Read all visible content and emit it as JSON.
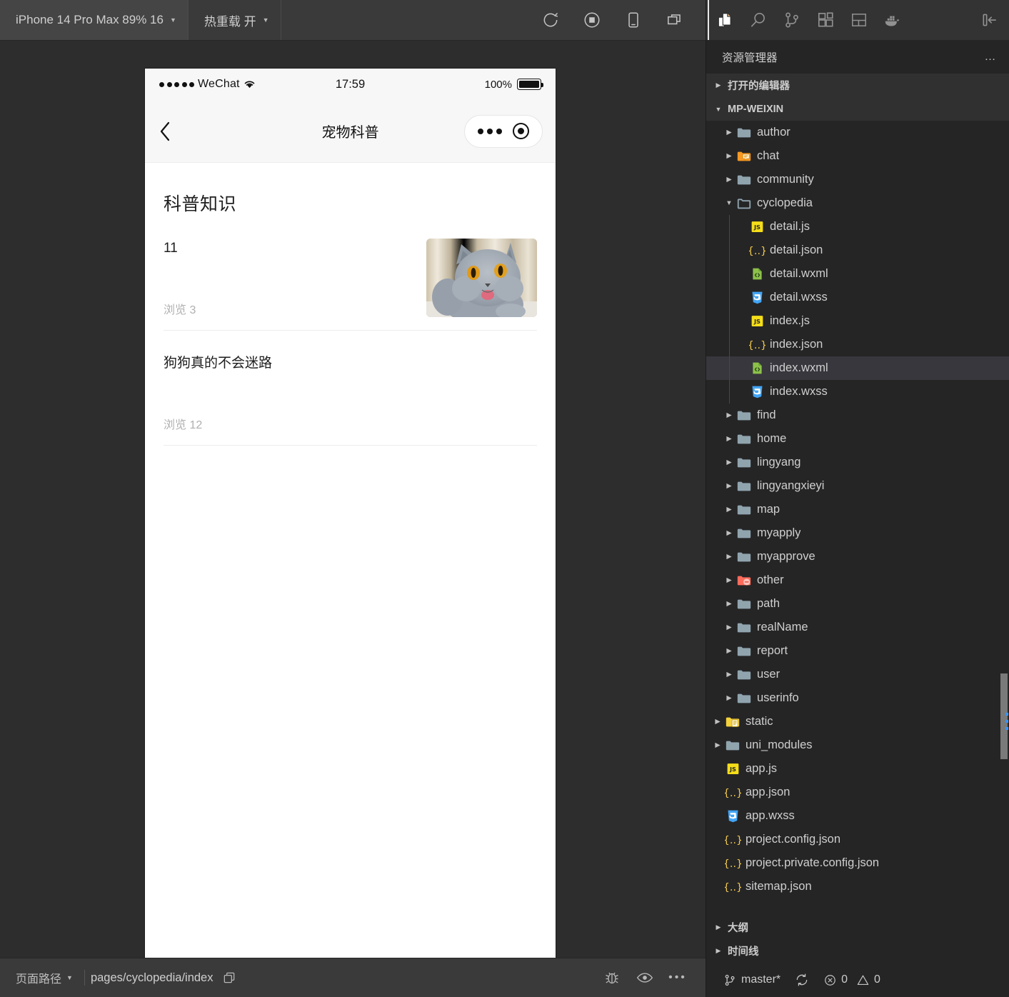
{
  "simulator": {
    "toolbar": {
      "device_label": "iPhone 14 Pro Max 89% 16",
      "hotreload_label": "热重载 开",
      "icons": [
        {
          "name": "refresh-icon",
          "title": "refresh"
        },
        {
          "name": "stop-record-icon",
          "title": "stop"
        },
        {
          "name": "device-icon",
          "title": "device"
        },
        {
          "name": "multi-window-icon",
          "title": "windows"
        }
      ]
    },
    "phone": {
      "status_bar": {
        "carrier": "WeChat",
        "time": "17:59",
        "battery_percent": "100%"
      },
      "nav_bar": {
        "back_icon": "chevron-left-icon",
        "title": "宠物科普",
        "capsule_more": "more-dots-icon",
        "capsule_target": "target-icon"
      },
      "page": {
        "heading": "科普知识",
        "articles": [
          {
            "title": "11",
            "views_label": "浏览",
            "views_count": "3",
            "has_thumb": true
          },
          {
            "title": "狗狗真的不会迷路",
            "views_label": "浏览",
            "views_count": "12",
            "has_thumb": false
          }
        ]
      }
    },
    "status_bar": {
      "page_path_label": "页面路径",
      "page_path_value": "pages/cyclopedia/index",
      "copy_icon": "copy-icon",
      "right_icons": [
        {
          "name": "bug-icon"
        },
        {
          "name": "eye-icon"
        },
        {
          "name": "more-dots-icon"
        }
      ]
    }
  },
  "vscode": {
    "activity_bar": [
      {
        "name": "explorer-icon",
        "label": "资源管理器",
        "active": true
      },
      {
        "name": "search-icon",
        "label": "搜索",
        "active": false
      },
      {
        "name": "source-control-icon",
        "label": "源代码管理",
        "active": false
      },
      {
        "name": "extensions-icon",
        "label": "扩展",
        "active": false
      },
      {
        "name": "layout-panel-icon",
        "label": "布局",
        "active": false
      },
      {
        "name": "docker-icon",
        "label": "Docker",
        "active": false
      }
    ],
    "collapse_icon": "collapse-panel-icon",
    "panel_title": "资源管理器",
    "panel_more": "…",
    "sections": {
      "open_editors": "打开的编辑器",
      "workspace": "MP-WEIXIN",
      "outline": "大纲",
      "timeline": "时间线"
    },
    "tree": [
      {
        "label": "author",
        "type": "folder",
        "indent": 1,
        "expanded": false,
        "icon": "folder-icon"
      },
      {
        "label": "chat",
        "type": "folder-chat",
        "indent": 1,
        "expanded": false,
        "icon": "folder-chat-icon"
      },
      {
        "label": "community",
        "type": "folder",
        "indent": 1,
        "expanded": false,
        "icon": "folder-icon"
      },
      {
        "label": "cyclopedia",
        "type": "folder",
        "indent": 1,
        "expanded": true,
        "icon": "folder-open-icon"
      },
      {
        "label": "detail.js",
        "type": "js",
        "indent": 2,
        "icon": "js-file-icon"
      },
      {
        "label": "detail.json",
        "type": "json",
        "indent": 2,
        "icon": "json-file-icon"
      },
      {
        "label": "detail.wxml",
        "type": "wxml",
        "indent": 2,
        "icon": "wxml-file-icon"
      },
      {
        "label": "detail.wxss",
        "type": "wxss",
        "indent": 2,
        "icon": "wxss-file-icon"
      },
      {
        "label": "index.js",
        "type": "js",
        "indent": 2,
        "icon": "js-file-icon"
      },
      {
        "label": "index.json",
        "type": "json",
        "indent": 2,
        "icon": "json-file-icon"
      },
      {
        "label": "index.wxml",
        "type": "wxml",
        "indent": 2,
        "icon": "wxml-file-icon",
        "selected": true
      },
      {
        "label": "index.wxss",
        "type": "wxss",
        "indent": 2,
        "icon": "wxss-file-icon"
      },
      {
        "label": "find",
        "type": "folder",
        "indent": 1,
        "expanded": false,
        "icon": "folder-icon"
      },
      {
        "label": "home",
        "type": "folder",
        "indent": 1,
        "expanded": false,
        "icon": "folder-icon"
      },
      {
        "label": "lingyang",
        "type": "folder",
        "indent": 1,
        "expanded": false,
        "icon": "folder-icon"
      },
      {
        "label": "lingyangxieyi",
        "type": "folder",
        "indent": 1,
        "expanded": false,
        "icon": "folder-icon"
      },
      {
        "label": "map",
        "type": "folder",
        "indent": 1,
        "expanded": false,
        "icon": "folder-icon"
      },
      {
        "label": "myapply",
        "type": "folder",
        "indent": 1,
        "expanded": false,
        "icon": "folder-icon"
      },
      {
        "label": "myapprove",
        "type": "folder",
        "indent": 1,
        "expanded": false,
        "icon": "folder-icon"
      },
      {
        "label": "other",
        "type": "folder-other",
        "indent": 1,
        "expanded": false,
        "icon": "folder-other-icon"
      },
      {
        "label": "path",
        "type": "folder",
        "indent": 1,
        "expanded": false,
        "icon": "folder-icon"
      },
      {
        "label": "realName",
        "type": "folder",
        "indent": 1,
        "expanded": false,
        "icon": "folder-icon"
      },
      {
        "label": "report",
        "type": "folder",
        "indent": 1,
        "expanded": false,
        "icon": "folder-icon"
      },
      {
        "label": "user",
        "type": "folder",
        "indent": 1,
        "expanded": false,
        "icon": "folder-icon"
      },
      {
        "label": "userinfo",
        "type": "folder",
        "indent": 1,
        "expanded": false,
        "icon": "folder-icon"
      },
      {
        "label": "static",
        "type": "folder-static",
        "indent": 0,
        "expanded": false,
        "icon": "folder-static-icon"
      },
      {
        "label": "uni_modules",
        "type": "folder",
        "indent": 0,
        "expanded": false,
        "icon": "folder-icon"
      },
      {
        "label": "app.js",
        "type": "js",
        "indent": 0,
        "icon": "js-file-icon"
      },
      {
        "label": "app.json",
        "type": "json",
        "indent": 0,
        "icon": "json-file-icon"
      },
      {
        "label": "app.wxss",
        "type": "wxss",
        "indent": 0,
        "icon": "wxss-file-icon"
      },
      {
        "label": "project.config.json",
        "type": "json",
        "indent": 0,
        "icon": "json-file-icon"
      },
      {
        "label": "project.private.config.json",
        "type": "json",
        "indent": 0,
        "icon": "json-file-icon"
      },
      {
        "label": "sitemap.json",
        "type": "json",
        "indent": 0,
        "icon": "json-file-icon"
      }
    ],
    "status_bar": {
      "branch_icon": "source-control-icon",
      "branch": "master*",
      "sync_icon": "sync-icon",
      "errors_icon": "error-icon",
      "errors": "0",
      "warnings_icon": "warning-icon",
      "warnings": "0"
    }
  },
  "colors": {
    "vs_bg": "#252526",
    "vs_activity_bg": "#333333",
    "selection": "#37373d",
    "sim_bg": "#2d2d2d",
    "toolbar_bg": "#3a3a3a",
    "accent_blue": "#3794ff",
    "folder_blue": "#90a4ae",
    "js_yellow": "#f5de19",
    "json_yellow": "#f2c94c",
    "wxml_green": "#8dc149",
    "wxss_blue": "#42a5f5",
    "chat_orange": "#f79922",
    "other_red": "#ff6b5b",
    "static_yellow": "#f5d13b"
  }
}
